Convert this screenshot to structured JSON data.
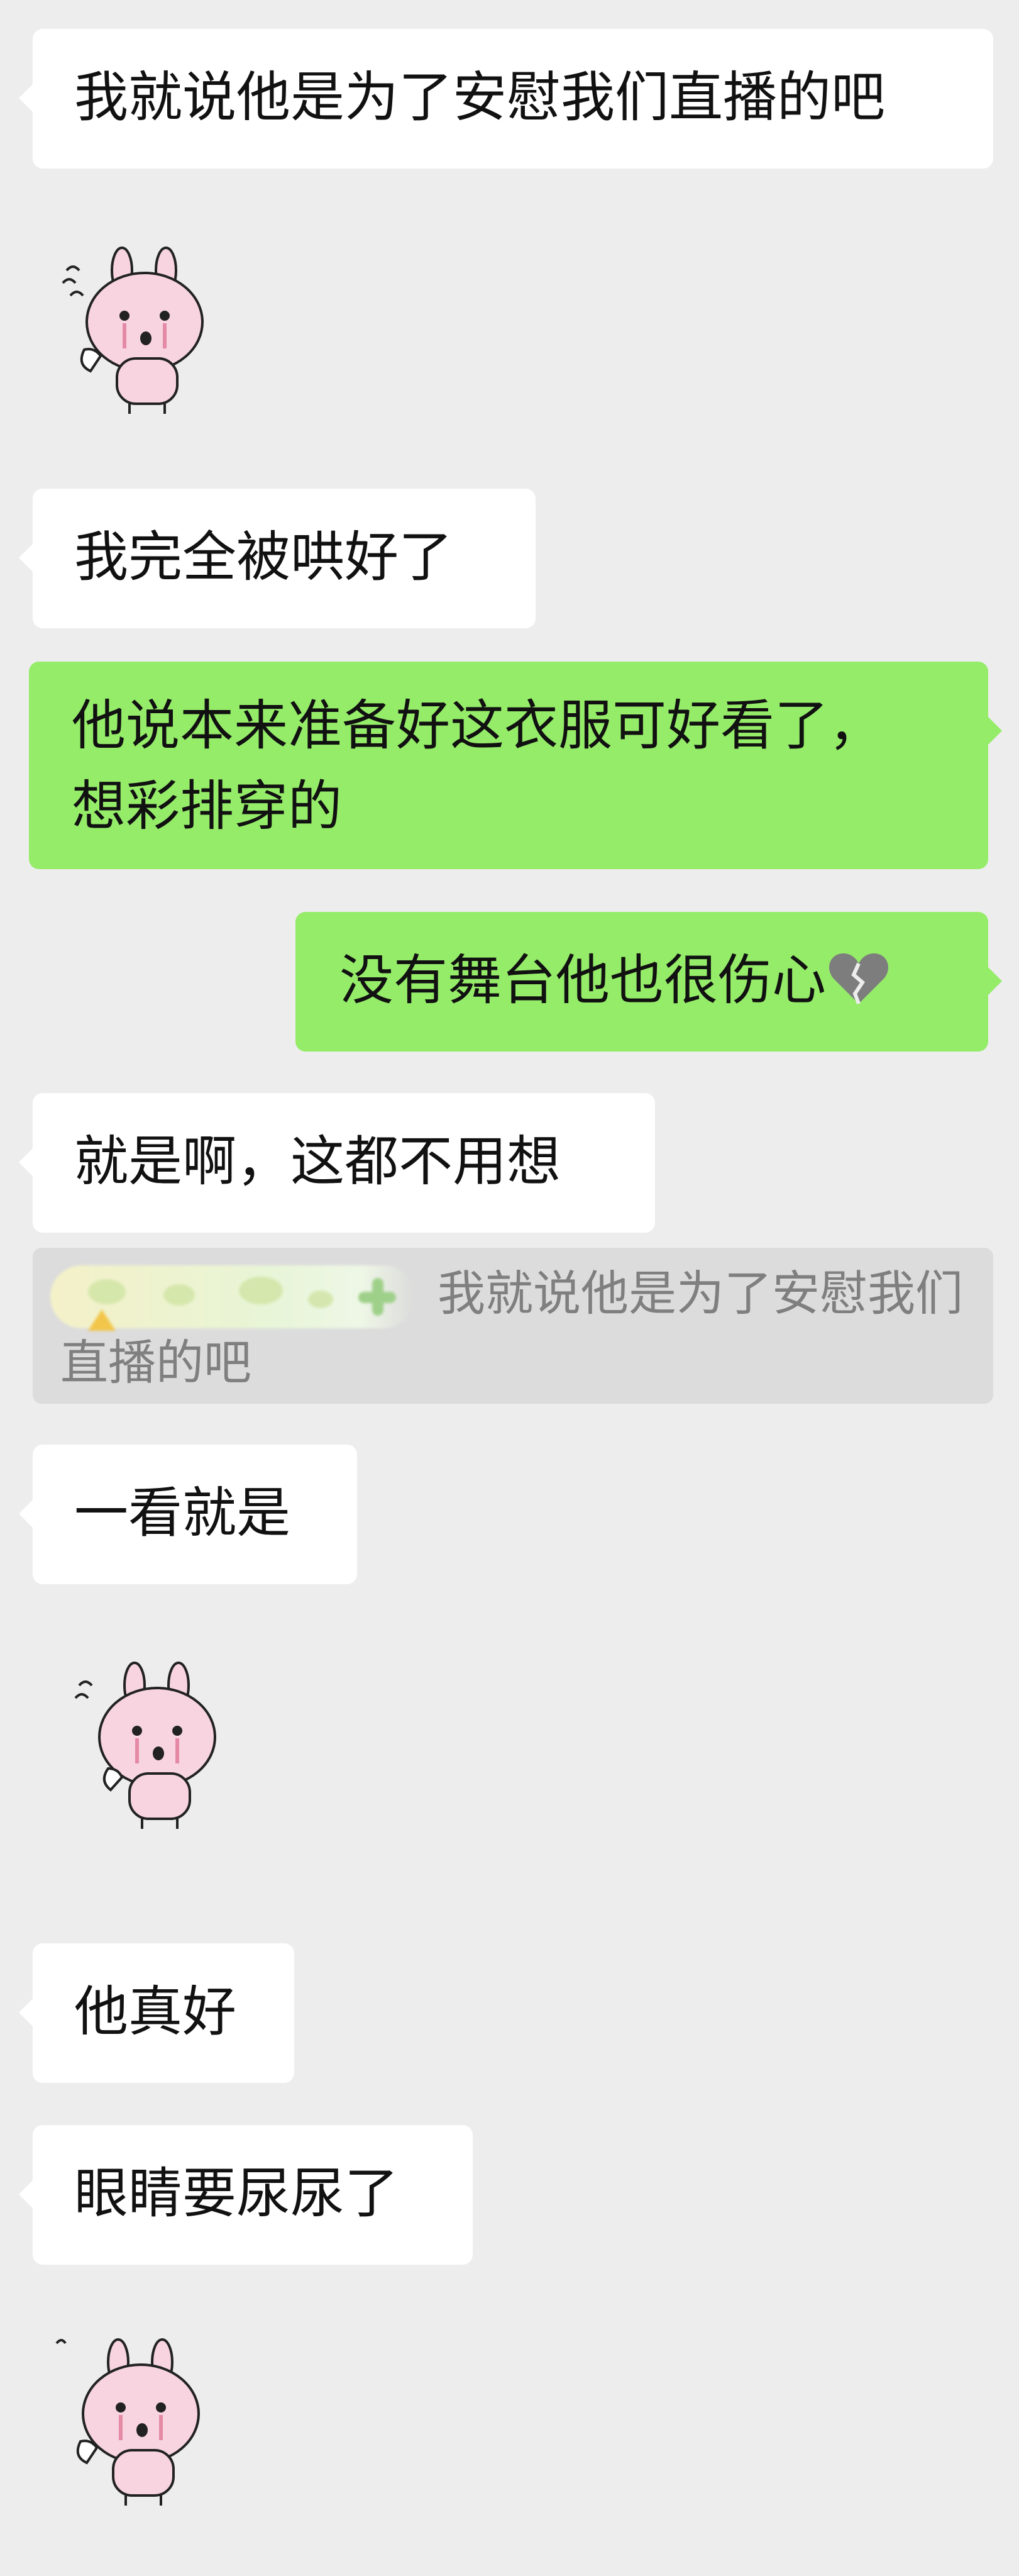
{
  "messages": [
    {
      "id": "m1",
      "side": "in",
      "text": "我就说他是为了安慰我们直播的吧"
    },
    {
      "id": "m2",
      "side": "in",
      "type": "sticker",
      "icon": "crying-bunny-sticker"
    },
    {
      "id": "m3",
      "side": "in",
      "text": "我完全被哄好了"
    },
    {
      "id": "m4",
      "side": "out",
      "lines": [
        "他说本来准备好这衣服可好看了，",
        "想彩排穿的"
      ]
    },
    {
      "id": "m5",
      "side": "out",
      "text": "没有舞台他也很伤心",
      "emoji": "broken-heart-emoji"
    },
    {
      "id": "m6",
      "side": "in",
      "text": "就是啊，这都不用想"
    },
    {
      "id": "m7",
      "type": "quote",
      "text": "我就说他是为了安慰我们直播的吧"
    },
    {
      "id": "m8",
      "side": "in",
      "text": "一看就是"
    },
    {
      "id": "m9",
      "side": "in",
      "type": "sticker",
      "icon": "crying-bunny-sticker"
    },
    {
      "id": "m10",
      "side": "in",
      "text": "他真好"
    },
    {
      "id": "m11",
      "side": "in",
      "text": "眼睛要尿尿了"
    },
    {
      "id": "m12",
      "side": "in",
      "type": "sticker",
      "icon": "crying-bunny-sticker"
    }
  ],
  "colors": {
    "background": "#ededed",
    "incoming_bubble": "#ffffff",
    "outgoing_bubble": "#95ec69",
    "quote_background": "#dcdcdc",
    "quote_text": "#7f7f7f"
  }
}
